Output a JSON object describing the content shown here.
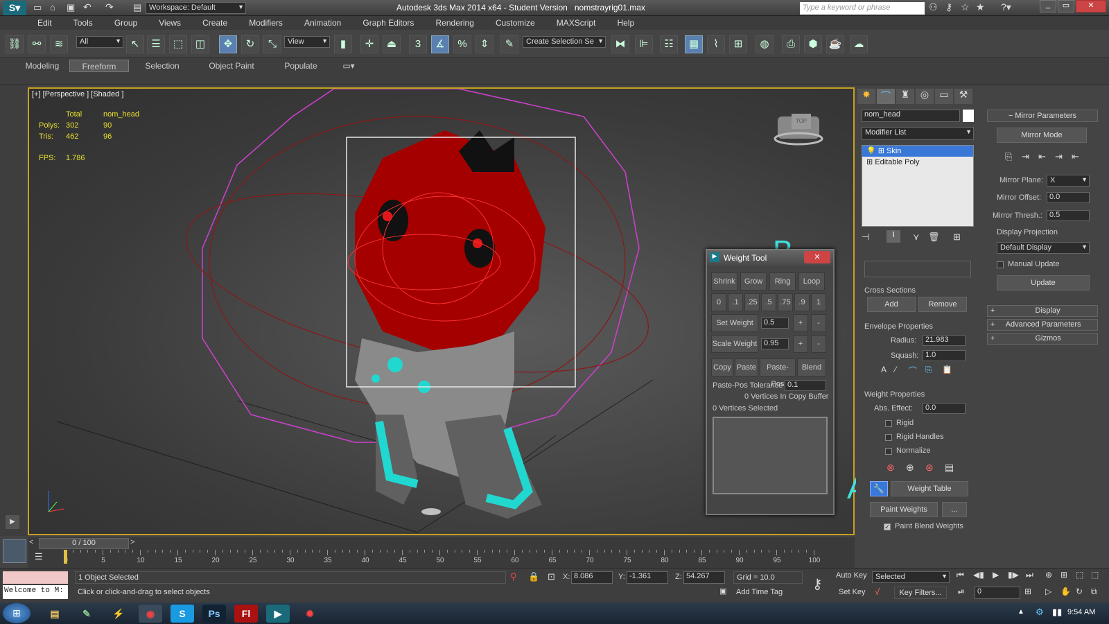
{
  "title": {
    "workspace": "Workspace: Default",
    "app_title": "Autodesk 3ds Max  2014 x64  - Student Version",
    "file_name": "nomstrayrig01.max",
    "search_placeholder": "Type a keyword or phrase"
  },
  "menu": [
    "Edit",
    "Tools",
    "Group",
    "Views",
    "Create",
    "Modifiers",
    "Animation",
    "Graph Editors",
    "Rendering",
    "Customize",
    "MAXScript",
    "Help"
  ],
  "toolbar": {
    "filter": "All",
    "ref_coord": "View",
    "named_sel": "Create Selection Se",
    "snap3": "3",
    "percent": "%"
  },
  "ribbon": {
    "tabs": [
      "Modeling",
      "Freeform",
      "Selection",
      "Object Paint",
      "Populate"
    ],
    "active_tab": "Freeform"
  },
  "viewport": {
    "label": "[+] [Perspective ] [Shaded ]",
    "stats_header_total": "Total",
    "stats_header_obj": "nom_head",
    "polys_label": "Polys:",
    "polys_total": "302",
    "polys_obj": "90",
    "tris_label": "Tris:",
    "tris_total": "462",
    "tris_obj": "96",
    "fps_label": "FPS:",
    "fps_value": "1.786"
  },
  "annotations": {
    "a": "A",
    "b": "B"
  },
  "weight_tool": {
    "title": "Weight Tool",
    "row1": [
      "Shrink",
      "Grow",
      "Ring",
      "Loop"
    ],
    "row2": [
      "0",
      ".1",
      ".25",
      ".5",
      ".75",
      ".9",
      "1"
    ],
    "set_weight": "Set Weight",
    "set_weight_value": "0.5",
    "scale_weight": "Scale Weight",
    "scale_weight_value": "0.95",
    "plus": "+",
    "minus": "-",
    "row3": [
      "Copy",
      "Paste",
      "Paste-Pos",
      "Blend"
    ],
    "paste_tol_label": "Paste-Pos Tolerance",
    "paste_tol_value": "0.1",
    "copy_buffer": "0 Vertices In Copy Buffer",
    "verts_selected": "0 Vertices Selected"
  },
  "command_panel": {
    "object_name": "nom_head",
    "modifier_list": "Modifier List",
    "stack": [
      "Skin",
      "Editable Poly"
    ],
    "cross_sections": "Cross Sections",
    "add": "Add",
    "remove": "Remove",
    "envelope_props": "Envelope Properties",
    "radius_label": "Radius:",
    "radius_value": "21.983",
    "squash_label": "Squash:",
    "squash_value": "1.0",
    "weight_props": "Weight Properties",
    "abs_effect_label": "Abs. Effect:",
    "abs_effect_value": "0.0",
    "rigid": "Rigid",
    "rigid_handles": "Rigid Handles",
    "normalize": "Normalize",
    "weight_table": "Weight Table",
    "paint_weights": "Paint Weights",
    "ellipsis": "...",
    "paint_blend": "Paint Blend Weights"
  },
  "mirror": {
    "header": "Mirror Parameters",
    "mirror_mode": "Mirror Mode",
    "plane_label": "Mirror Plane:",
    "plane_value": "X",
    "offset_label": "Mirror Offset:",
    "offset_value": "0.0",
    "thresh_label": "Mirror Thresh.:",
    "thresh_value": "0.5",
    "display_proj": "Display Projection",
    "default_display": "Default Display",
    "manual_update": "Manual Update",
    "update": "Update",
    "display": "Display",
    "advanced": "Advanced Parameters",
    "gizmos": "Gizmos"
  },
  "timeline": {
    "frame": "0 / 100",
    "ticks": [
      "0",
      "5",
      "10",
      "15",
      "20",
      "25",
      "30",
      "35",
      "40",
      "45",
      "50",
      "55",
      "60",
      "65",
      "70",
      "75",
      "80",
      "85",
      "90",
      "95",
      "100"
    ]
  },
  "status": {
    "selected": "1 Object Selected",
    "prompt": "Click or click-and-drag to select objects",
    "welcome": "Welcome to M:",
    "x_label": "X:",
    "x": "8.086",
    "y_label": "Y:",
    "y": "-1.361",
    "z_label": "Z:",
    "z": "54.267",
    "grid": "Grid = 10.0",
    "add_time_tag": "Add Time Tag",
    "auto_key": "Auto Key",
    "set_key": "Set Key",
    "selected_dd": "Selected",
    "key_filters": "Key Filters...",
    "frame_field": "0"
  },
  "taskbar": {
    "clock": "9:54 AM"
  }
}
